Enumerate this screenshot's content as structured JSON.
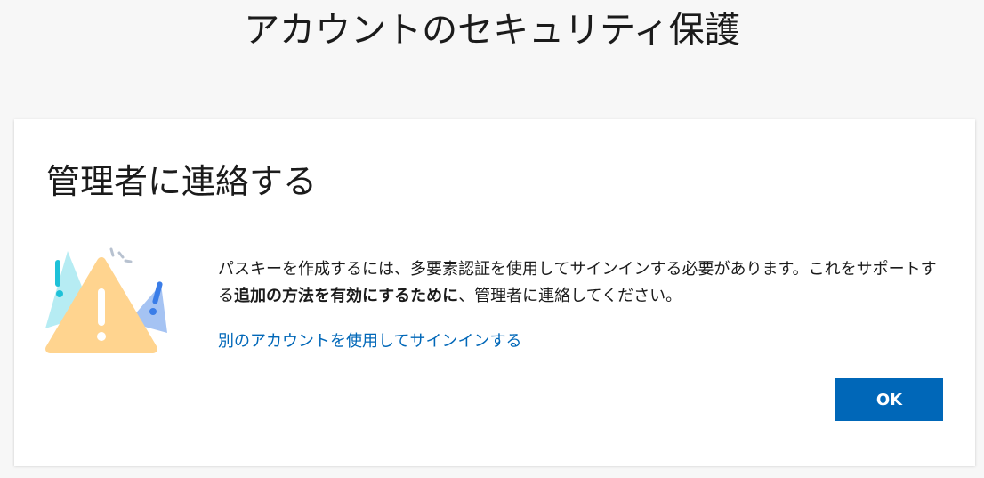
{
  "header": {
    "title": "アカウントのセキュリティ保護"
  },
  "dialog": {
    "heading": "管理者に連絡する",
    "message_part1": "パスキーを作成するには、多要素認証を使用してサインインする必要があります。これをサポートする",
    "message_bold": "追加の方法を有効にするために",
    "message_part2": "、管理者に連絡してください。",
    "alt_link": "別のアカウントを使用してサインインする",
    "ok_label": "OK",
    "illustration_icon": "warning-triangle-icon"
  },
  "colors": {
    "accent": "#0067b8",
    "warning_triangle": "#ffd48f",
    "teal_triangle": "#9fe3ef",
    "blue_triangle": "#8ab4f0"
  }
}
